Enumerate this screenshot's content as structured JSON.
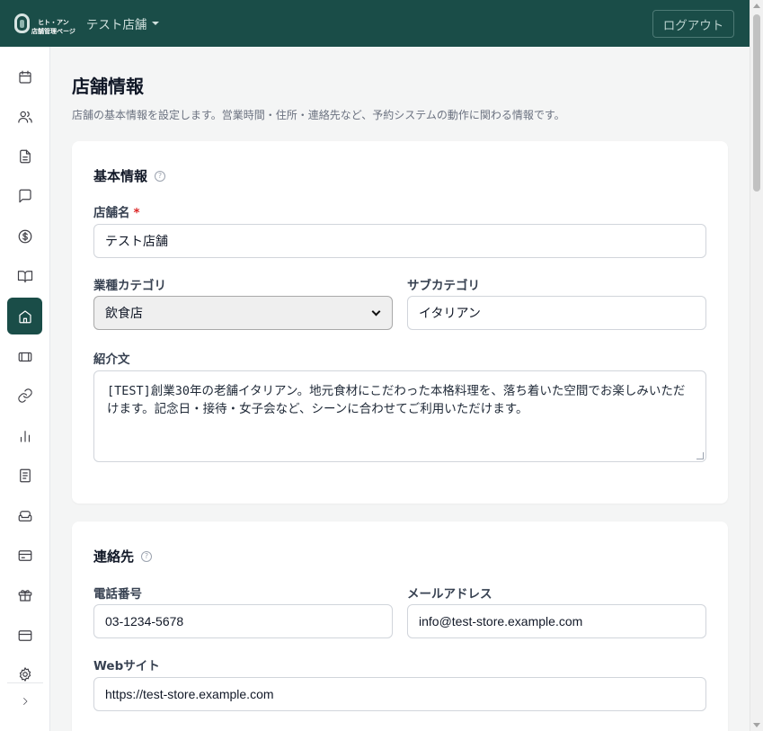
{
  "header": {
    "logo_line1": "ヒト・アン",
    "logo_line2": "店舗管理ページ",
    "store_name": "テスト店舗",
    "logout_label": "ログアウト"
  },
  "sidebar": {
    "items": [
      {
        "icon": "calendar-icon"
      },
      {
        "icon": "users-icon"
      },
      {
        "icon": "document-icon"
      },
      {
        "icon": "chat-icon"
      },
      {
        "icon": "dollar-icon"
      },
      {
        "icon": "book-open-icon"
      },
      {
        "icon": "home-icon",
        "active": true
      },
      {
        "icon": "ticket-icon"
      },
      {
        "icon": "link-icon"
      },
      {
        "icon": "bar-chart-icon"
      },
      {
        "icon": "notebook-icon"
      },
      {
        "icon": "sofa-icon"
      },
      {
        "icon": "card-icon"
      },
      {
        "icon": "gift-icon"
      },
      {
        "icon": "credit-card-icon"
      },
      {
        "icon": "settings-icon"
      }
    ],
    "expand_icon": "chevron-right-icon"
  },
  "page": {
    "title": "店舗情報",
    "description": "店舗の基本情報を設定します。営業時間・住所・連絡先など、予約システムの動作に関わる情報です。"
  },
  "basic_info": {
    "title": "基本情報",
    "help": "?",
    "store_name_label": "店舗名",
    "required_mark": "*",
    "store_name_value": "テスト店舗",
    "category_label": "業種カテゴリ",
    "category_value": "飲食店",
    "subcategory_label": "サブカテゴリ",
    "subcategory_value": "イタリアン",
    "intro_label": "紹介文",
    "intro_value": "[TEST]創業30年の老舗イタリアン。地元食材にこだわった本格料理を、落ち着いた空間でお楽しみいただけます。記念日・接待・女子会など、シーンに合わせてご利用いただけます。"
  },
  "contact": {
    "title": "連絡先",
    "help": "?",
    "phone_label": "電話番号",
    "phone_value": "03-1234-5678",
    "email_label": "メールアドレス",
    "email_value": "info@test-store.example.com",
    "website_label": "Webサイト",
    "website_value": "https://test-store.example.com"
  },
  "colors": {
    "brand": "#1a4d48",
    "required": "#dc2626"
  }
}
